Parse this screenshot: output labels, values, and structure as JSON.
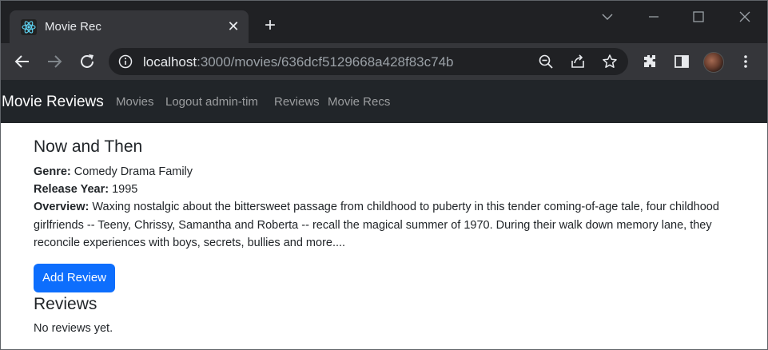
{
  "browser": {
    "tab_title": "Movie Rec",
    "tab_icon": "react-icon",
    "url_host": "localhost",
    "url_path": ":3000/movies/636dcf5129668a428f83c74b"
  },
  "navbar": {
    "brand": "Movie Reviews",
    "links": [
      "Movies",
      "Logout admin-tim",
      "Reviews",
      "Movie Recs"
    ]
  },
  "movie": {
    "title": "Now and Then",
    "genre_label": "Genre:",
    "genre": "Comedy Drama Family",
    "year_label": "Release Year:",
    "year": "1995",
    "overview_label": "Overview:",
    "overview": "Waxing nostalgic about the bittersweet passage from childhood to puberty in this tender coming-of-age tale, four childhood girlfriends -- Teeny, Chrissy, Samantha and Roberta -- recall the magical summer of 1970. During their walk down memory lane, they reconcile experiences with boys, secrets, bullies and more...."
  },
  "actions": {
    "add_review": "Add Review"
  },
  "reviews": {
    "heading": "Reviews",
    "empty_text": "No reviews yet."
  },
  "colors": {
    "navbar_bg": "#212529",
    "primary_button": "#0d6efd",
    "chrome_dark": "#202124",
    "chrome_toolbar": "#35363a"
  }
}
